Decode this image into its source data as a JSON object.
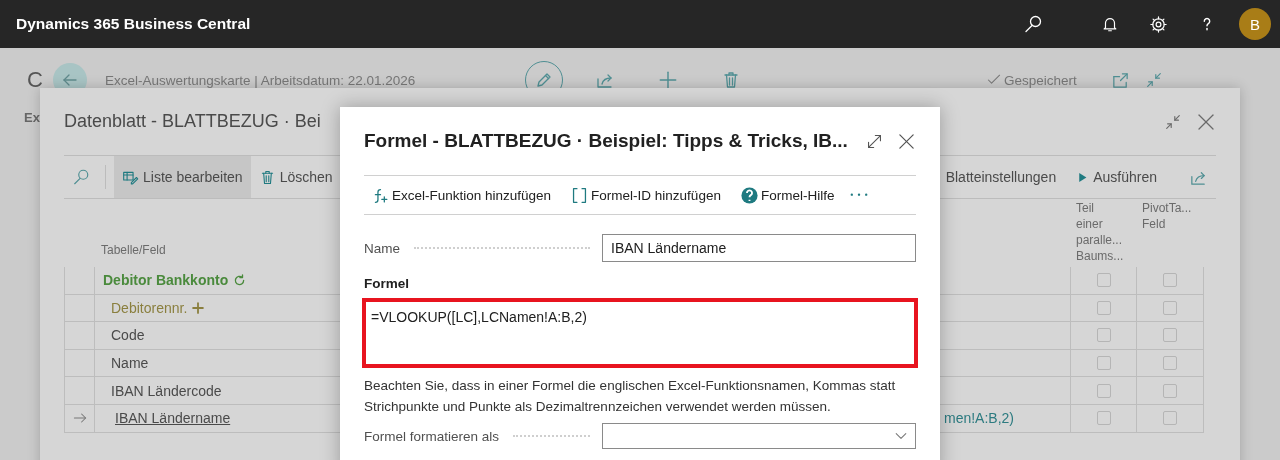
{
  "top_bar": {
    "brand": "Dynamics 365 Business Central",
    "avatar": "B"
  },
  "page": {
    "heading": "C",
    "section": "Ex",
    "title": "Excel-Auswertungskarte | Arbeitsdatum: 22.01.2026",
    "status": "Gespeichert"
  },
  "datasheet": {
    "title": "Datenblatt - BLATTBEZUG · Bei",
    "actions": [
      {
        "label": "Liste bearbeiten",
        "selected": true
      },
      {
        "label": "Löschen",
        "selected": false
      }
    ],
    "right_actions": [
      {
        "label": "Blatteinstellungen"
      },
      {
        "label": "Ausführen"
      }
    ],
    "columns": [
      {
        "lines": [
          "Tabelle/Feld"
        ]
      },
      {
        "lines": [
          "Teil",
          "einer",
          "paralle...",
          "Baums..."
        ]
      },
      {
        "lines": [
          "PivotTa...",
          "Feld"
        ]
      }
    ],
    "rows": [
      {
        "kind": "table",
        "field": "Debitor Bankkonto",
        "current": false,
        "parallel": false,
        "pivot": false
      },
      {
        "kind": "key",
        "field": "Debitorennr.",
        "current": false,
        "parallel": false,
        "pivot": false
      },
      {
        "kind": "field",
        "field": "Code",
        "current": false,
        "parallel": false,
        "pivot": false
      },
      {
        "kind": "field",
        "field": "Name",
        "current": false,
        "parallel": false,
        "pivot": false
      },
      {
        "kind": "field",
        "field": "IBAN Ländercode",
        "current": false,
        "parallel": false,
        "pivot": false
      },
      {
        "kind": "field",
        "field": "IBAN Ländername",
        "formula": "men!A:B,2)",
        "current": true,
        "parallel": false,
        "pivot": false
      }
    ]
  },
  "formula_dialog": {
    "title": "Formel - BLATTBEZUG · Beispiel: Tipps & Tricks, IB...",
    "actions": [
      {
        "label": "Excel-Funktion hinzufügen"
      },
      {
        "label": "Formel-ID hinzufügen"
      },
      {
        "label": "Formel-Hilfe"
      }
    ],
    "name_label": "Name",
    "name_value": "IBAN Ländername",
    "formula_label": "Formel",
    "formula_value": "=VLOOKUP([LC],LCNamen!A:B,2)",
    "formula_highlighted": true,
    "note": "Beachten Sie, dass in einer Formel die englischen Excel-Funktionsnamen, Kommas statt Strichpunkte und Punkte als Dezimaltrennzeichen verwendet werden müssen.",
    "format_label": "Formel formatieren als"
  }
}
